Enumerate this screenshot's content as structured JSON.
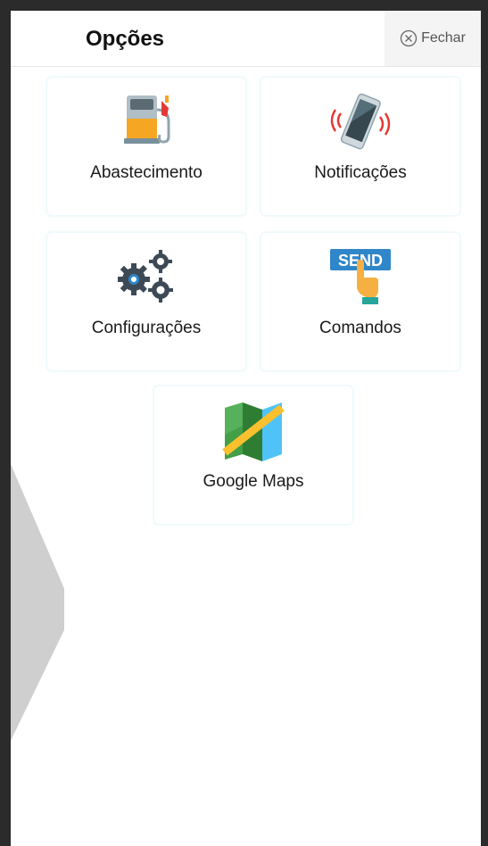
{
  "header": {
    "title": "Opções",
    "close_label": "Fechar"
  },
  "options": [
    {
      "label": "Abastecimento",
      "icon": "fuel-pump-icon"
    },
    {
      "label": "Notificações",
      "icon": "vibrating-phone-icon"
    },
    {
      "label": "Configurações",
      "icon": "gears-icon"
    },
    {
      "label": "Comandos",
      "icon": "send-command-icon",
      "icon_text": "SEND"
    },
    {
      "label": "Google Maps",
      "icon": "map-icon"
    }
  ],
  "colors": {
    "header_border": "#e4e4e4",
    "close_bg": "#f4f4f4",
    "gear": "#3d4a56",
    "gear_accent": "#2f86c9",
    "send_blue": "#2f86c9",
    "fuel_orange": "#f5a623",
    "map_green": "#43a047",
    "map_yellow": "#fbc02d"
  }
}
